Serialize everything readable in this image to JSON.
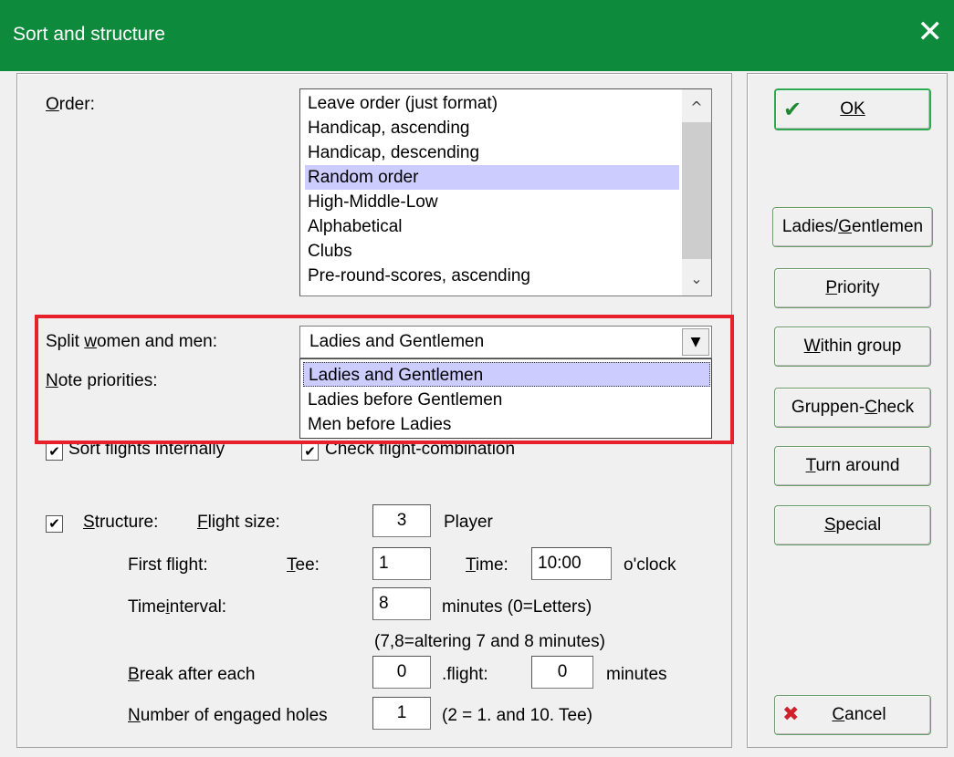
{
  "window": {
    "title": "Sort and structure",
    "close_glyph": "✕"
  },
  "order": {
    "label": "Order:",
    "items": [
      "Leave order (just format)",
      "Handicap, ascending",
      "Handicap, descending",
      "Random order",
      "High-Middle-Low",
      "Alphabetical",
      "Clubs",
      "Pre-round-scores, ascending"
    ],
    "selected": "Random order",
    "scroll_up": "^",
    "scroll_down": "⌄"
  },
  "split": {
    "label": "Split women and men:",
    "value": "Ladies and Gentlemen",
    "drop_glyph": "▼",
    "options": [
      "Ladies and Gentlemen",
      "Ladies before Gentlemen",
      "Men before Ladies"
    ],
    "highlight_color": "#e8202a"
  },
  "priorities": {
    "label": "Note priorities:"
  },
  "sort_flights": {
    "label": "Sort flights internally",
    "checked": true,
    "mark": "✔"
  },
  "check_flight": {
    "label": "Check flight-combination",
    "checked": true,
    "mark": "✔"
  },
  "structure": {
    "label": "Structure:",
    "checked": true,
    "mark": "✔",
    "flight_size_label": "Flight size:",
    "flight_size": "3",
    "player_label": "Player",
    "first_flight_label": "First flight:",
    "tee_label": "Tee:",
    "tee": "1",
    "time_label": "Time:",
    "time": "10:00",
    "oclock_label": "o'clock",
    "interval_label": "Timeinterval:",
    "interval": "8",
    "interval_unit": "minutes (0=Letters)",
    "interval_note": "(7,8=altering 7 and 8 minutes)",
    "break_label": "Break after each",
    "break_flights": "0",
    "break_flight_unit": ".flight:",
    "break_minutes": "0",
    "break_minutes_unit": "minutes",
    "holes_label": "Number of engaged holes",
    "holes": "1",
    "holes_note": "(2 = 1. and 10. Tee)"
  },
  "buttons": {
    "ok": "OK",
    "ok_icon": "✔",
    "ladies": "Ladies/Gentlemen",
    "priority": "Priority",
    "within_group": "Within group",
    "gruppen_check": "Gruppen-Check",
    "turn_around": "Turn around",
    "special": "Special",
    "cancel": "Cancel",
    "cancel_icon": "✖"
  },
  "colors": {
    "title_bar": "#0e8a3c",
    "selection": "#ccccff",
    "ok_icon": "#1e8a30",
    "cancel_icon": "#d0202a"
  }
}
